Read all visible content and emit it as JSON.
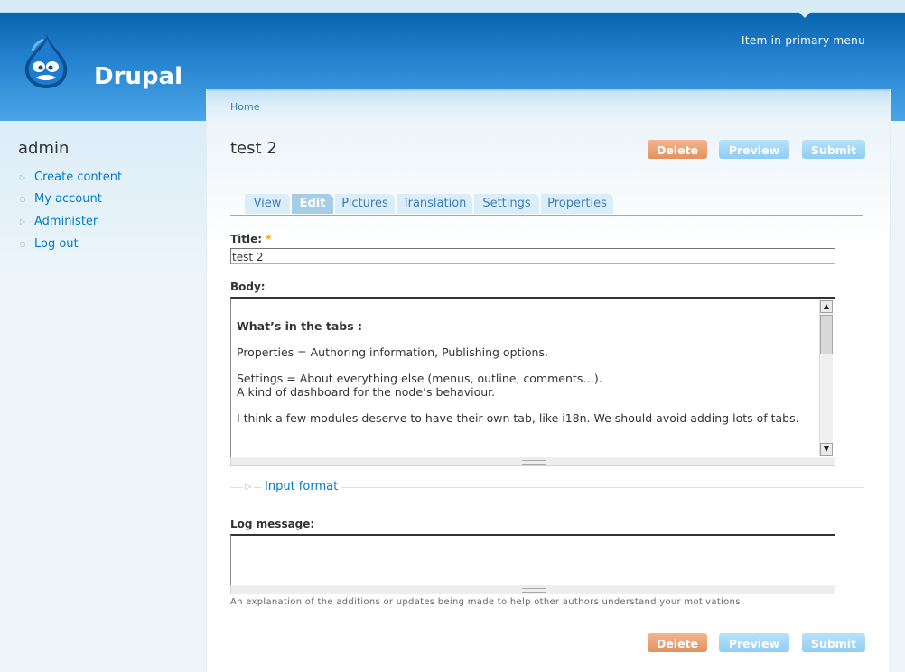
{
  "site": {
    "name": "Drupal",
    "primary_menu_item": "Item in primary menu"
  },
  "sidebar": {
    "user": "admin",
    "items": [
      {
        "label": "Create content"
      },
      {
        "label": "My account"
      },
      {
        "label": "Administer"
      },
      {
        "label": "Log out"
      }
    ]
  },
  "breadcrumb": "Home",
  "page": {
    "title": "test 2"
  },
  "actions": {
    "delete": "Delete",
    "preview": "Preview",
    "submit": "Submit"
  },
  "tabs": [
    {
      "label": "View",
      "active": false
    },
    {
      "label": "Edit",
      "active": true
    },
    {
      "label": "Pictures",
      "active": false
    },
    {
      "label": "Translation",
      "active": false
    },
    {
      "label": "Settings",
      "active": false
    },
    {
      "label": "Properties",
      "active": false
    }
  ],
  "form": {
    "title_label": "Title:",
    "required_mark": "*",
    "title_value": "test 2",
    "body_label": "Body:",
    "body_lines": [
      "What’s in the tabs :",
      "Properties = Authoring information, Publishing options.",
      "Settings = About everything else (menus, outline, comments…).",
      "A kind of dashboard for the node’s behaviour.",
      "I think a few modules deserve to have their own tab, like i18n. We should avoid adding lots of tabs."
    ],
    "input_format_label": "Input format",
    "log_label": "Log message:",
    "log_value": "",
    "log_help": "An explanation of the additions or updates being made to help other authors understand your motivations."
  },
  "colors": {
    "link": "#027ac6",
    "delete_button": "#e3925e",
    "preview_button": "#8fcdf5",
    "header_top": "#0a64b0",
    "header_bottom": "#4ba5e6"
  }
}
